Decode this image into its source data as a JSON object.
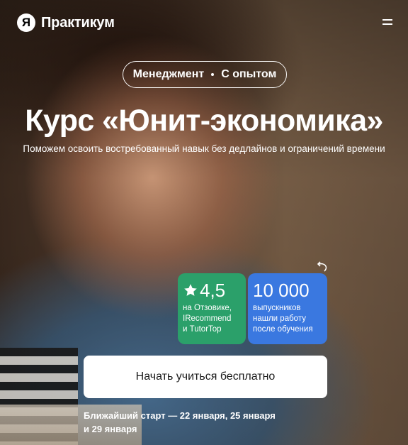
{
  "header": {
    "logo_mark": "Я",
    "logo_text": "Практикум"
  },
  "tags": {
    "area": "Менеджмент",
    "level": "С опытом"
  },
  "hero": {
    "title": "Курс «Юнит-экономика»",
    "subtitle": "Поможем освоить востребованный навык без дедлайнов и ограничений времени"
  },
  "stats": {
    "rating": {
      "value": "4,5",
      "lines": [
        "на Отзовике,",
        "IRecommend",
        "и TutorTop"
      ]
    },
    "graduates": {
      "value": "10 000",
      "lines": [
        "выпускников",
        "нашли работу",
        "после обучения"
      ]
    }
  },
  "cta": {
    "label": "Начать учиться бесплатно"
  },
  "start": {
    "line1": "Ближайший старт — 22 января, 25 января",
    "line2": "и 29 января"
  },
  "colors": {
    "rating_card": "#2ba06a",
    "graduates_card": "#3a78e0"
  }
}
